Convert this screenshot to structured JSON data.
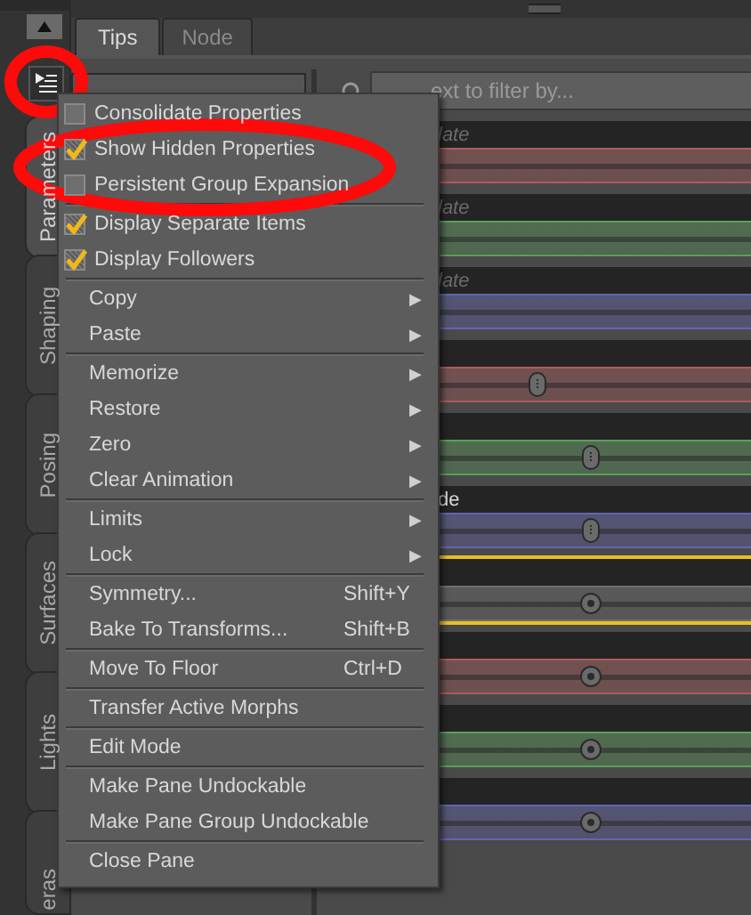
{
  "side_tabs": [
    {
      "label": "Parameters",
      "selected": true
    },
    {
      "label": "Shaping",
      "selected": false
    },
    {
      "label": "Posing",
      "selected": false
    },
    {
      "label": "Surfaces",
      "selected": false
    },
    {
      "label": "Lights",
      "selected": false
    },
    {
      "label": "eras",
      "selected": false
    }
  ],
  "pane_menu_button": {
    "highlighted": true
  },
  "tabs": [
    {
      "label": "Tips",
      "selected": true
    },
    {
      "label": "Node",
      "selected": false
    }
  ],
  "filter": {
    "placeholder": "ext to filter by..."
  },
  "properties": [
    {
      "label": "late",
      "muted": true,
      "color": "#b05a5a",
      "selected": false
    },
    {
      "label": "late",
      "muted": true,
      "color": "#5aa05a",
      "selected": false
    },
    {
      "label": "late",
      "muted": true,
      "color": "#6464b4",
      "selected": false
    },
    {
      "color": "#b05a5a",
      "kind": "oval",
      "level": 0.51,
      "selected": false
    },
    {
      "color": "#5aa05a",
      "kind": "oval",
      "level": 0.63,
      "selected": false
    },
    {
      "label": "de",
      "muted": false,
      "color": "#6464b4",
      "kind": "oval",
      "level": 0.63,
      "selected": false
    },
    {
      "color": "#707070",
      "kind": "round",
      "level": 0.63,
      "selected": true
    },
    {
      "color": "#b05a5a",
      "kind": "round",
      "level": 0.63,
      "selected": false
    },
    {
      "color": "#5aa05a",
      "kind": "round",
      "level": 0.63,
      "selected": false
    },
    {
      "color": "#6464b4",
      "kind": "round",
      "level": 0.63,
      "selected": false
    }
  ],
  "menu": [
    {
      "kind": "check",
      "label": "Consolidate Properties",
      "checked": false,
      "highlighted": false
    },
    {
      "kind": "check",
      "label": "Show Hidden Properties",
      "checked": true,
      "highlighted": true
    },
    {
      "kind": "check",
      "label": "Persistent Group Expansion",
      "checked": false,
      "highlighted": true
    },
    {
      "kind": "separator"
    },
    {
      "kind": "check",
      "label": "Display Separate Items",
      "checked": true,
      "highlighted": false
    },
    {
      "kind": "check",
      "label": "Display Followers",
      "checked": true,
      "highlighted": false
    },
    {
      "kind": "separator"
    },
    {
      "kind": "submenu",
      "label": "Copy",
      "arrow": "▶"
    },
    {
      "kind": "submenu",
      "label": "Paste",
      "arrow": "▶"
    },
    {
      "kind": "separator"
    },
    {
      "kind": "submenu",
      "label": "Memorize",
      "arrow": "▶"
    },
    {
      "kind": "submenu",
      "label": "Restore",
      "arrow": "▶"
    },
    {
      "kind": "submenu",
      "label": "Zero",
      "arrow": "▶"
    },
    {
      "kind": "submenu",
      "label": "Clear Animation",
      "arrow": "▶"
    },
    {
      "kind": "separator"
    },
    {
      "kind": "submenu",
      "label": "Limits",
      "arrow": "▶"
    },
    {
      "kind": "submenu",
      "label": "Lock",
      "arrow": "▶"
    },
    {
      "kind": "separator"
    },
    {
      "kind": "action",
      "label": "Symmetry...",
      "shortcut": "Shift+Y"
    },
    {
      "kind": "action",
      "label": "Bake To Transforms...",
      "shortcut": "Shift+B"
    },
    {
      "kind": "separator"
    },
    {
      "kind": "action",
      "label": "Move To Floor",
      "shortcut": "Ctrl+D"
    },
    {
      "kind": "separator"
    },
    {
      "kind": "action",
      "label": "Transfer Active Morphs"
    },
    {
      "kind": "separator"
    },
    {
      "kind": "action",
      "label": "Edit Mode"
    },
    {
      "kind": "separator"
    },
    {
      "kind": "action",
      "label": "Make Pane Undockable"
    },
    {
      "kind": "action",
      "label": "Make Pane Group Undockable"
    },
    {
      "kind": "separator"
    },
    {
      "kind": "action",
      "label": "Close Pane"
    }
  ]
}
